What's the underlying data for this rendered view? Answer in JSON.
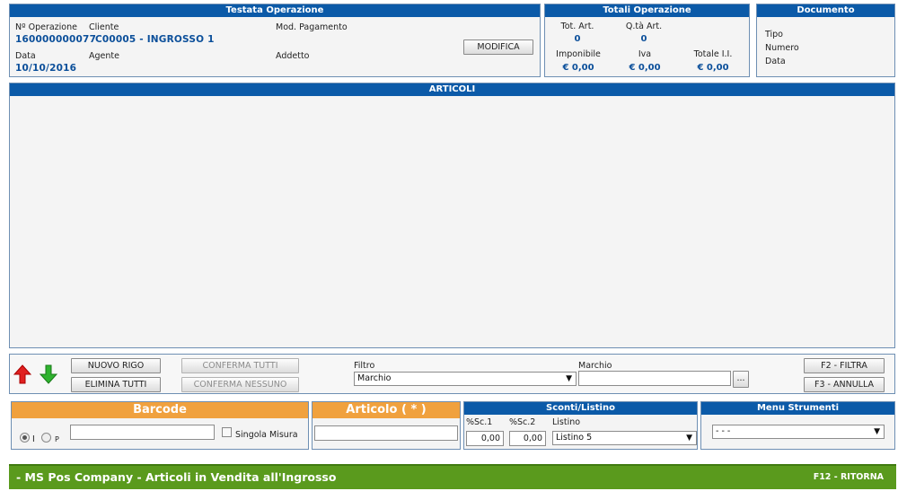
{
  "testata": {
    "title": "Testata Operazione",
    "num_op_label": "Nº Operazione",
    "num_op_value": "160000000077",
    "cliente_label": "Cliente",
    "cliente_value": "C00005 - INGROSSO 1",
    "mod_pag_label": "Mod. Pagamento",
    "data_label": "Data",
    "data_value": "10/10/2016",
    "agente_label": "Agente",
    "addetto_label": "Addetto",
    "modifica_label": "MODIFICA"
  },
  "totali": {
    "title": "Totali Operazione",
    "tot_art_label": "Tot. Art.",
    "tot_art_value": "0",
    "qta_label": "Q.tà Art.",
    "qta_value": "0",
    "imponibile_label": "Imponibile",
    "imponibile_value": "€ 0,00",
    "iva_label": "Iva",
    "iva_value": "€ 0,00",
    "totale_label": "Totale I.I.",
    "totale_value": "€ 0,00"
  },
  "documento": {
    "title": "Documento",
    "tipo_label": "Tipo",
    "numero_label": "Numero",
    "data_label": "Data"
  },
  "articoli": {
    "title": "ARTICOLI"
  },
  "toolbar": {
    "nuovo_rigo": "NUOVO RIGO",
    "elimina_tutti": "ELIMINA TUTTI",
    "conferma_tutti": "CONFERMA TUTTI",
    "conferma_nessuno": "CONFERMA NESSUNO",
    "filtro_label": "Filtro",
    "filtro_value": "Marchio",
    "marchio_label": "Marchio",
    "marchio_value": "",
    "browse_label": "...",
    "filtra_label": "F2 - FILTRA",
    "annulla_label": "F3 - ANNULLA"
  },
  "barcode": {
    "title": "Barcode",
    "radio_i": "I",
    "radio_p": "P",
    "input_value": "",
    "singola_misura": "Singola Misura"
  },
  "articolo": {
    "title": "Articolo ( * )",
    "input_value": ""
  },
  "sconti": {
    "title": "Sconti/Listino",
    "sc1_label": "%Sc.1",
    "sc1_value": "0,00",
    "sc2_label": "%Sc.2",
    "sc2_value": "0,00",
    "listino_label": "Listino",
    "listino_value": "Listino 5"
  },
  "strumenti": {
    "title": "Menu Strumenti",
    "select_value": "- - -"
  },
  "footer": {
    "title": "- MS Pos Company - Articoli in Vendita all'Ingrosso",
    "ritorna": "F12 - RITORNA"
  },
  "colors": {
    "header_blue": "#0b5aa8",
    "value_blue": "#0b4f9a",
    "orange": "#f0a13e",
    "footer_green": "#5a9a1d"
  },
  "icons": [
    "arrow-up-red-icon",
    "arrow-down-green-icon",
    "dropdown-arrow-icon"
  ]
}
